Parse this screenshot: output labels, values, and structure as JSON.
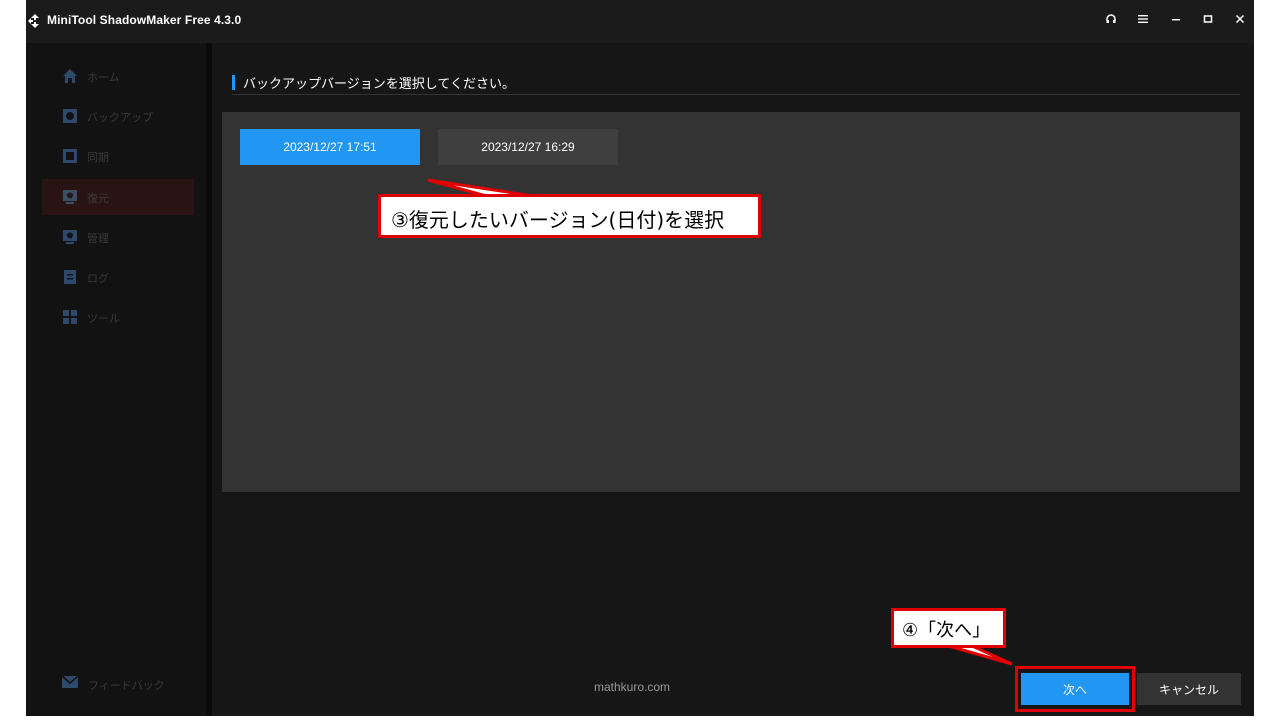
{
  "window": {
    "title": "MiniTool ShadowMaker Free 4.3.0",
    "controls": [
      "headset-icon",
      "menu-icon",
      "minimize-icon",
      "maximize-icon",
      "close-icon"
    ]
  },
  "sidebar": {
    "items": [
      {
        "label": "ホーム",
        "icon": "home-icon"
      },
      {
        "label": "バックアップ",
        "icon": "backup-icon"
      },
      {
        "label": "同期",
        "icon": "sync-icon"
      },
      {
        "label": "復元",
        "icon": "restore-icon",
        "active": true
      },
      {
        "label": "管理",
        "icon": "manage-icon"
      },
      {
        "label": "ログ",
        "icon": "log-icon"
      },
      {
        "label": "ツール",
        "icon": "tools-icon"
      }
    ],
    "feedback_label": "フィードバック"
  },
  "main": {
    "heading": "バックアップバージョンを選択してください。",
    "versions": [
      {
        "label": "2023/12/27 17:51",
        "selected": true
      },
      {
        "label": "2023/12/27 16:29",
        "selected": false
      }
    ],
    "footer_text": "mathkuro.com",
    "next_label": "次へ",
    "cancel_label": "キャンセル"
  },
  "annotations": {
    "callout_3": "③復元したいバージョン(日付)を選択",
    "callout_4": "④「次へ」"
  },
  "colors": {
    "accent": "#2196f3",
    "callout_border": "#e00000",
    "background": "#161616",
    "panel": "#333333"
  }
}
